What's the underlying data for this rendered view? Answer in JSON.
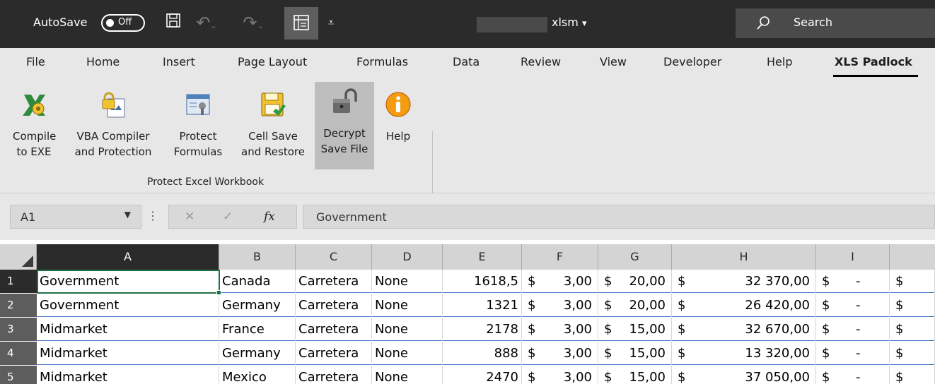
{
  "titlebar": {
    "autosave_label": "AutoSave",
    "autosave_state": "Off",
    "filename": "xlsm",
    "filename_chevron": "▾",
    "search_placeholder": "Search",
    "icons": [
      "save-icon",
      "undo-icon",
      "redo-icon",
      "form-icon",
      "customize-qat-icon",
      "search-icon"
    ]
  },
  "ribbon": {
    "tabs": [
      "File",
      "Home",
      "Insert",
      "Page Layout",
      "Formulas",
      "Data",
      "Review",
      "View",
      "Developer",
      "Help",
      "XLS Padlock"
    ],
    "active_tab": "XLS Padlock",
    "buttons": [
      {
        "label": "Compile\nto EXE",
        "icon": "compile-exe-icon"
      },
      {
        "label": "VBA Compiler\nand Protection",
        "icon": "vba-compiler-icon"
      },
      {
        "label": "Protect\nFormulas",
        "icon": "protect-formulas-icon"
      },
      {
        "label": "Cell Save\nand Restore",
        "icon": "cell-save-icon"
      },
      {
        "label": "Decrypt\nSave File",
        "icon": "padlock-open-icon"
      },
      {
        "label": "Help",
        "icon": "info-icon"
      }
    ],
    "group_label": "Protect Excel Workbook"
  },
  "formula_bar": {
    "name_box": "A1",
    "cancel_glyph": "✕",
    "enter_glyph": "✓",
    "fx_glyph": "fx",
    "formula": "Government"
  },
  "grid": {
    "columns": [
      "A",
      "B",
      "C",
      "D",
      "E",
      "F",
      "G",
      "H",
      "I",
      ""
    ],
    "selected_column": "A",
    "rows": [
      {
        "num": "1",
        "a": "Government",
        "b": "Canada",
        "c": "Carretera",
        "d": "None",
        "e": "1618,5",
        "f": "3,00",
        "g": "20,00",
        "h": "32 370,00",
        "i": "-"
      },
      {
        "num": "2",
        "a": "Government",
        "b": "Germany",
        "c": "Carretera",
        "d": "None",
        "e": "1321",
        "f": "3,00",
        "g": "20,00",
        "h": "26 420,00",
        "i": "-"
      },
      {
        "num": "3",
        "a": "Midmarket",
        "b": "France",
        "c": "Carretera",
        "d": "None",
        "e": "2178",
        "f": "3,00",
        "g": "15,00",
        "h": "32 670,00",
        "i": "-"
      },
      {
        "num": "4",
        "a": "Midmarket",
        "b": "Germany",
        "c": "Carretera",
        "d": "None",
        "e": "888",
        "f": "3,00",
        "g": "15,00",
        "h": "13 320,00",
        "i": "-"
      },
      {
        "num": "5",
        "a": "Midmarket",
        "b": "Mexico",
        "c": "Carretera",
        "d": "None",
        "e": "2470",
        "f": "3,00",
        "g": "15,00",
        "h": "37 050,00",
        "i": "-"
      }
    ],
    "currency_symbol": "$"
  },
  "colors": {
    "titlebar_bg": "#2b2b2b",
    "ribbon_bg": "#e7e7e7",
    "selection_green": "#1e7145",
    "row_border_blue": "#4c78c9"
  }
}
